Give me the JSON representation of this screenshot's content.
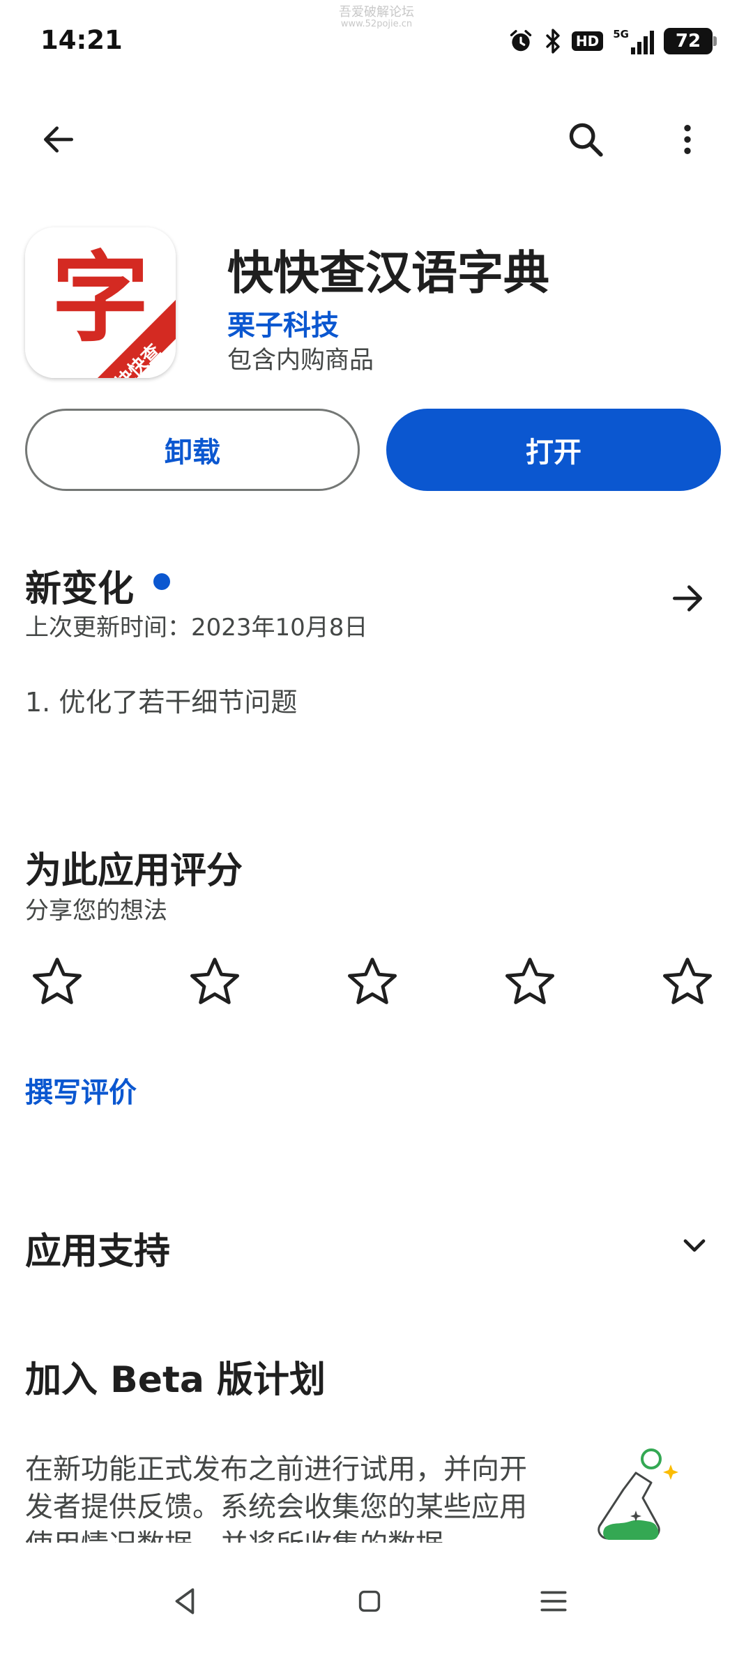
{
  "status_bar": {
    "time": "14:21",
    "watermark_line1": "吾爱破解论坛",
    "watermark_line2": "www.52pojie.cn",
    "hd_label": "HD",
    "network_label": "5G",
    "battery": "72",
    "icons": [
      "alarm-icon",
      "bluetooth-icon",
      "hd-icon",
      "signal-icon",
      "battery-icon"
    ]
  },
  "toolbar": {
    "icons": [
      "back-arrow-icon",
      "search-icon",
      "more-vert-icon"
    ]
  },
  "app": {
    "icon_glyph": "字",
    "icon_ribbon": "快快查",
    "name": "快快查汉语字典",
    "developer": "栗子科技",
    "in_app_purchases": "包含内购商品"
  },
  "actions": {
    "uninstall_label": "卸载",
    "open_label": "打开"
  },
  "whats_new": {
    "title": "新变化",
    "last_updated": "上次更新时间：2023年10月8日",
    "notes": "1. 优化了若干细节问题"
  },
  "rate": {
    "title": "为此应用评分",
    "subtitle": "分享您的想法",
    "stars": 5,
    "rating": 0,
    "write_review_label": "撰写评价"
  },
  "support": {
    "title": "应用支持"
  },
  "beta": {
    "title": "加入 Beta 版计划",
    "description": "在新功能正式发布之前进行试用，并向开发者提供反馈。系统会收集您的某些应用使用情况数据，并将所收集的数据"
  },
  "colors": {
    "accent": "#0b57d0",
    "text_primary": "#1f1f1f",
    "text_secondary": "#444746",
    "outline": "#747775",
    "icon_red": "#d42a22"
  }
}
